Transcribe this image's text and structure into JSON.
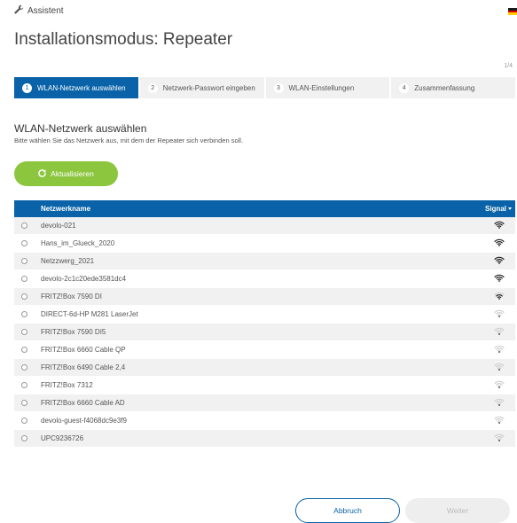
{
  "header": {
    "assistant_label": "Assistent",
    "title": "Installationsmodus: Repeater",
    "step_count": "1/4",
    "flag_colors": [
      "#1a1a1a",
      "#dd0000",
      "#ffce00"
    ]
  },
  "steps": [
    {
      "num": "1",
      "label": "WLAN-Netzwerk auswählen",
      "active": true
    },
    {
      "num": "2",
      "label": "Netzwerk-Passwort eingeben",
      "active": false
    },
    {
      "num": "3",
      "label": "WLAN-Einstellungen",
      "active": false
    },
    {
      "num": "4",
      "label": "Zusammenfassung",
      "active": false
    }
  ],
  "main": {
    "subtitle": "WLAN-Netzwerk auswählen",
    "description": "Bitte wählen Sie das Netzwerk aus, mit dem der Repeater sich verbinden soll.",
    "refresh_label": "Aktualisieren"
  },
  "table": {
    "col_name": "Netzwerkname",
    "col_signal": "Signal",
    "rows": [
      {
        "name": "devolo-021",
        "signal": 4
      },
      {
        "name": "Hans_im_Glueck_2020",
        "signal": 4
      },
      {
        "name": "Netzzwerg_2021",
        "signal": 4
      },
      {
        "name": "devolo-2c1c20ede3581dc4",
        "signal": 4
      },
      {
        "name": "FRITZ!Box 7590 DI",
        "signal": 3
      },
      {
        "name": "DIRECT-6d-HP M281 LaserJet",
        "signal": 1
      },
      {
        "name": "FRITZ!Box 7590 DI5",
        "signal": 1
      },
      {
        "name": "FRITZ!Box 6660 Cable QP",
        "signal": 1
      },
      {
        "name": "FRITZ!Box 6490 Cable 2,4",
        "signal": 1
      },
      {
        "name": "FRITZ!Box 7312",
        "signal": 1
      },
      {
        "name": "FRITZ!Box 6660 Cable AD",
        "signal": 1
      },
      {
        "name": "devolo-guest-f4068dc9e3f9",
        "signal": 1
      },
      {
        "name": "UPC9236726",
        "signal": 1
      }
    ]
  },
  "footer": {
    "cancel_label": "Abbruch",
    "next_label": "Weiter"
  },
  "colors": {
    "primary": "#0a63a8",
    "accent_green": "#8cc63f"
  }
}
